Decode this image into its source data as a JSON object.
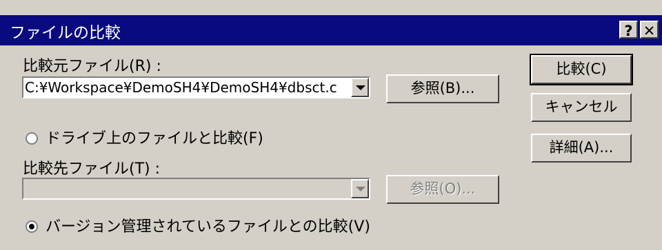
{
  "window": {
    "title": "ファイルの比較",
    "help_glyph": "?",
    "close_glyph": "✕"
  },
  "source": {
    "label": "比較元ファイル(R) :",
    "value": "C:¥Workspace¥DemoSH4¥DemoSH4¥dbsct.c",
    "browse_label": "参照(B)..."
  },
  "radio_drive": {
    "label": "ドライブ上のファイルと比較(F)",
    "checked": false
  },
  "target": {
    "label": "比較先ファイル(T) :",
    "value": "",
    "browse_label": "参照(O)..."
  },
  "radio_version": {
    "label": "バージョン管理されているファイルとの比較(V)",
    "checked": true
  },
  "buttons": {
    "compare": "比較(C)",
    "cancel": "キャンセル",
    "details": "詳細(A)..."
  },
  "colors": {
    "titlebar": "#0a0a80",
    "face": "#d4d0c8"
  }
}
